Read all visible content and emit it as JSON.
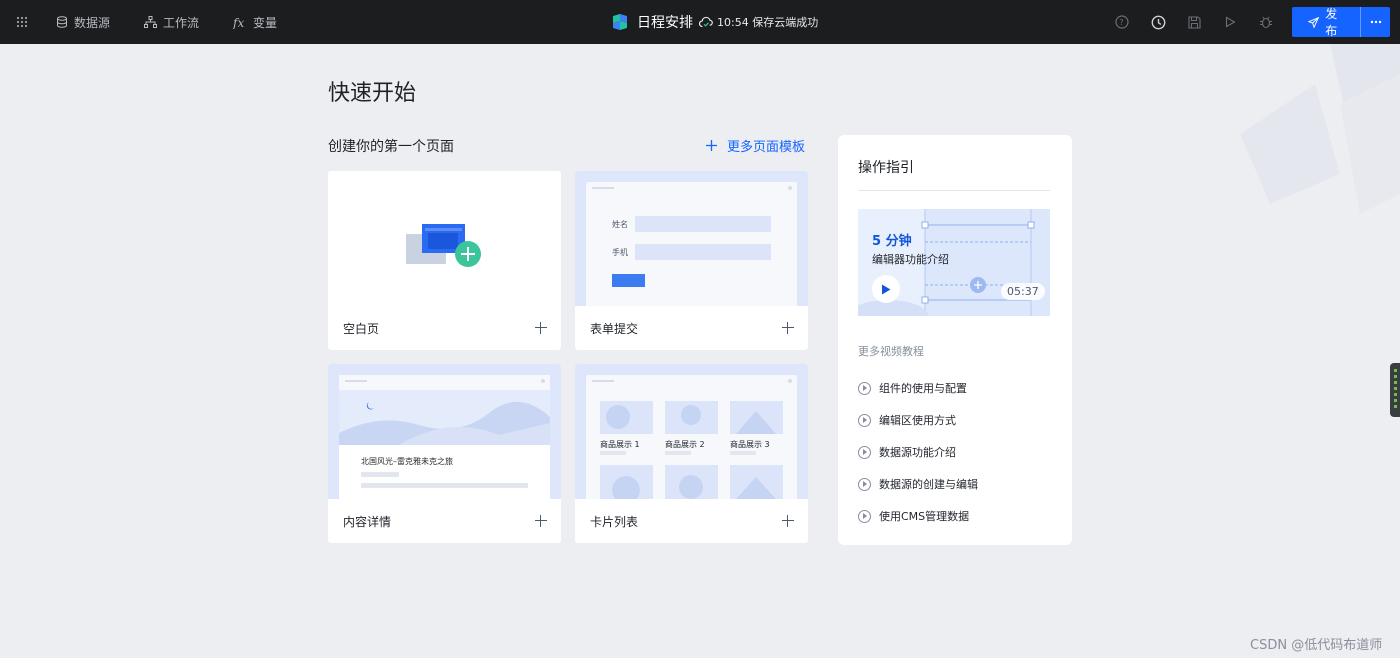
{
  "topbar": {
    "nav": [
      {
        "label": "数据源",
        "icon": "database-icon"
      },
      {
        "label": "工作流",
        "icon": "workflow-icon"
      },
      {
        "label": "变量",
        "icon": "function-icon"
      }
    ],
    "app_title": "日程安排",
    "save_status": "10:54 保存云端成功",
    "publish_label": "发布",
    "right_icons": [
      "help-icon",
      "history-icon",
      "save-icon",
      "preview-play-icon",
      "debug-icon"
    ]
  },
  "main": {
    "page_title": "快速开始",
    "section_title": "创建你的第一个页面",
    "more_templates": "更多页面模板",
    "cards": [
      {
        "label": "空白页"
      },
      {
        "label": "表单提交",
        "form_labels": [
          "姓名",
          "手机"
        ]
      },
      {
        "label": "内容详情",
        "preview_heading": "北国风光–雷克雅未克之旅"
      },
      {
        "label": "卡片列表",
        "items": [
          "商品展示 1",
          "商品展示 2",
          "商品展示 3"
        ]
      }
    ]
  },
  "guide": {
    "title": "操作指引",
    "video": {
      "minutes": "5 分钟",
      "subtitle": "编辑器功能介绍",
      "duration": "05:37"
    },
    "more_videos": "更多视频教程",
    "tutorials": [
      "组件的使用与配置",
      "编辑区使用方式",
      "数据源功能介绍",
      "数据源的创建与编辑",
      "使用CMS管理数据"
    ]
  },
  "watermark": "CSDN @低代码布道师",
  "colors": {
    "accent": "#1664ff",
    "topbar": "#1c1d1f",
    "page_bg": "#eceef2"
  }
}
